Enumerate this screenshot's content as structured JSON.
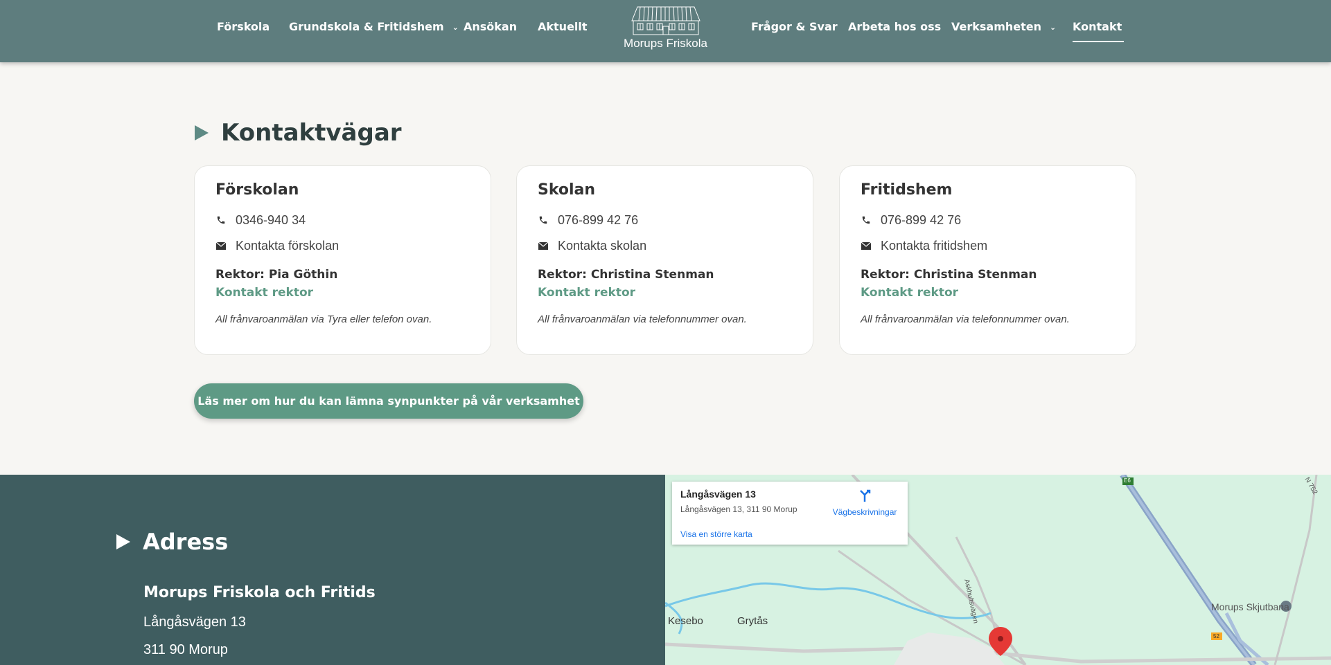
{
  "header": {
    "nav_left": [
      {
        "label": "Förskola"
      },
      {
        "label": "Grundskola & Fritidshem"
      },
      {
        "label": "Ansökan"
      },
      {
        "label": "Aktuellt"
      }
    ],
    "nav_right": [
      {
        "label": "Frågor & Svar"
      },
      {
        "label": "Arbeta hos oss"
      },
      {
        "label": "Verksamheten"
      },
      {
        "label": "Kontakt"
      }
    ],
    "logo_text": "Morups Friskola"
  },
  "contact": {
    "title": "Kontaktvägar",
    "cards": [
      {
        "title": "Förskolan",
        "phone": "0346-940 34",
        "email_label": "Kontakta förskolan",
        "rektor": "Rektor: Pia Göthin",
        "rektor_link": "Kontakt rektor",
        "note": "All frånvaroanmälan via Tyra eller telefon ovan."
      },
      {
        "title": "Skolan",
        "phone": "076-899 42 76",
        "email_label": "Kontakta skolan",
        "rektor": "Rektor: Christina Stenman",
        "rektor_link": "Kontakt rektor",
        "note": "All frånvaroanmälan via telefonnummer ovan."
      },
      {
        "title": "Fritidshem",
        "phone": "076-899 42 76",
        "email_label": "Kontakta fritidshem",
        "rektor": "Rektor: Christina Stenman",
        "rektor_link": "Kontakt rektor",
        "note": "All frånvaroanmälan via telefonnummer ovan."
      }
    ],
    "cta_label": "Läs mer om hur du kan lämna synpunkter på vår verksamhet"
  },
  "address": {
    "title": "Adress",
    "name": "Morups Friskola och Fritids",
    "street": "Långåsvägen 13",
    "postal": "311 90 Morup"
  },
  "map": {
    "card_title": "Långåsvägen 13",
    "card_subtitle": "Långåsvägen 13, 311 90 Morup",
    "directions_label": "Vägbeskrivningar",
    "larger_map_label": "Visa en större karta",
    "labels": [
      "Kesebo",
      "Grytås",
      "Morups Skjutbana",
      "Askhultsvägen",
      "E6",
      "N 752",
      "52"
    ]
  },
  "colors": {
    "header_bg": "#5e7d7e",
    "accent": "#5e9a85",
    "footer_bg": "#3f5d60",
    "page_bg": "#f7f6f3"
  }
}
